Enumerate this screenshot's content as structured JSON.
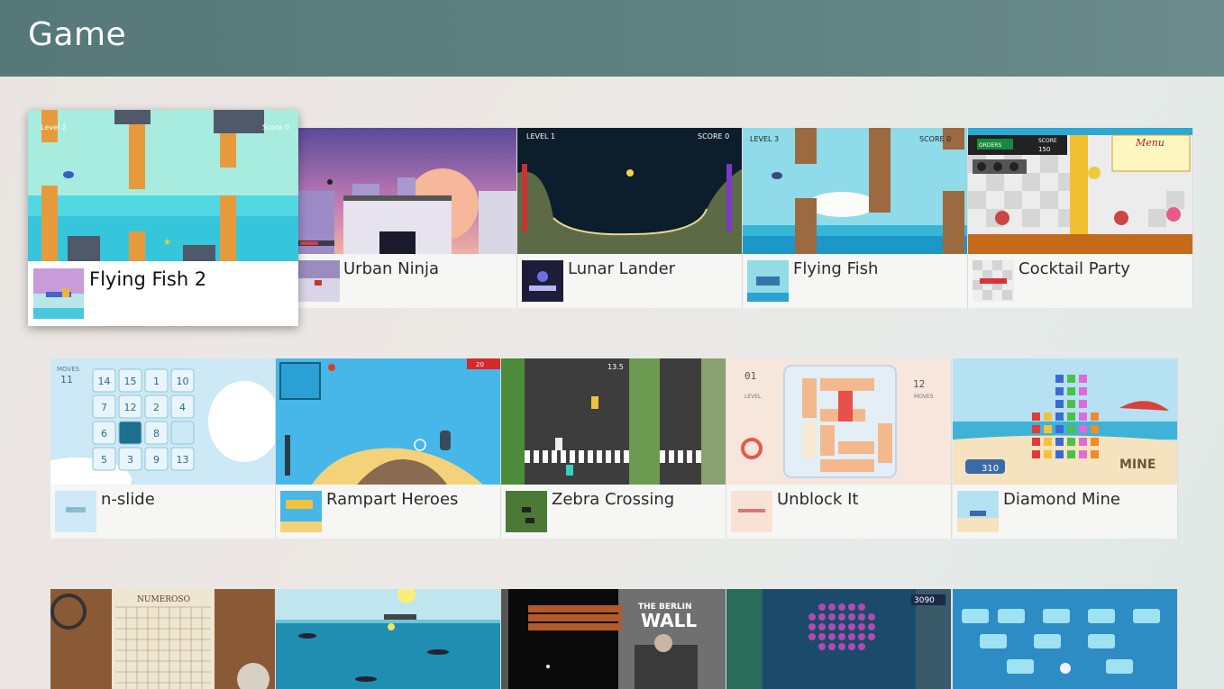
{
  "header": {
    "title": "Game"
  },
  "rows": [
    [
      {
        "name": "Flying Fish 2"
      },
      {
        "name": "Urban Ninja"
      },
      {
        "name": "Lunar Lander"
      },
      {
        "name": "Flying Fish"
      },
      {
        "name": "Cocktail Party"
      }
    ],
    [
      {
        "name": "n-slide"
      },
      {
        "name": "Rampart Heroes"
      },
      {
        "name": "Zebra Crossing"
      },
      {
        "name": "Unblock It"
      },
      {
        "name": "Diamond Mine"
      }
    ]
  ],
  "thumb_text": {
    "ff2_level": "Level 2",
    "ff2_score": "Score 0",
    "lunar_level": "LEVEL 1",
    "lunar_score": "SCORE 0",
    "ff_level": "LEVEL 3",
    "ff_score": "SCORE 0",
    "cocktail_orders": "ORDERS",
    "cocktail_score": "SCORE",
    "cocktail_score_val": "150",
    "cocktail_menu": "Menu",
    "nslide_moves": "MOVES",
    "nslide_moves_val": "11",
    "nslide_cells": [
      "14",
      "15",
      "1",
      "10",
      "7",
      "12",
      "2",
      "4",
      "6",
      "",
      "8",
      "",
      "5",
      "3",
      "9",
      "13"
    ],
    "rampart_score": "20",
    "zebra_timer": "13.5",
    "unblock_level": "LEVEL",
    "unblock_level_val": "01",
    "unblock_moves": "MOVES",
    "unblock_moves_val": "12",
    "diamond_score": "310",
    "diamond_logo": "MINE",
    "numeroso_title": "NUMEROSO",
    "berlin_wall_the": "THE BERLIN",
    "berlin_wall": "WALL",
    "space_score": "3090"
  }
}
